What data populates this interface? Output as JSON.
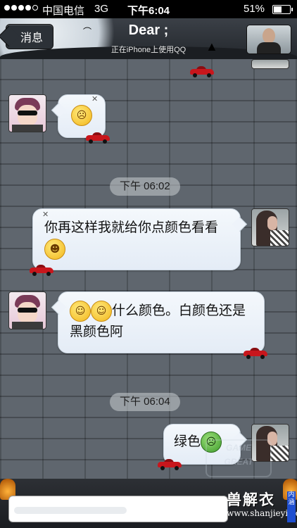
{
  "status_bar": {
    "carrier": "中国电信",
    "network": "3G",
    "time": "下午6:04",
    "battery": "51%"
  },
  "nav": {
    "back_label": "消息",
    "title": "Dear ;",
    "subtitle": "正在iPhone上使用QQ"
  },
  "messages": {
    "m1_emoji": "☹",
    "time1": "下午 06:02",
    "m2_text": "你再这样我就给你点颜色看看",
    "m2_emoji": "☻",
    "m3_text": "什么颜色。白颜色还是黑颜色阿",
    "m3_emoji": "☺",
    "time2": "下午 06:04",
    "m4_text": "绿色",
    "m4_emoji": "☹"
  },
  "bottom": {
    "brand_cn": "兽解衣",
    "brand_url": "www.shanjieyi.com",
    "brand_tag": "内涵"
  },
  "watermark": {
    "line1": "GAME",
    "line2": "GREAT"
  },
  "colors": {
    "bubble_bg": "#eef3fa",
    "nav_bg": "#2c3137",
    "brand_blue": "#1f4fd0"
  }
}
